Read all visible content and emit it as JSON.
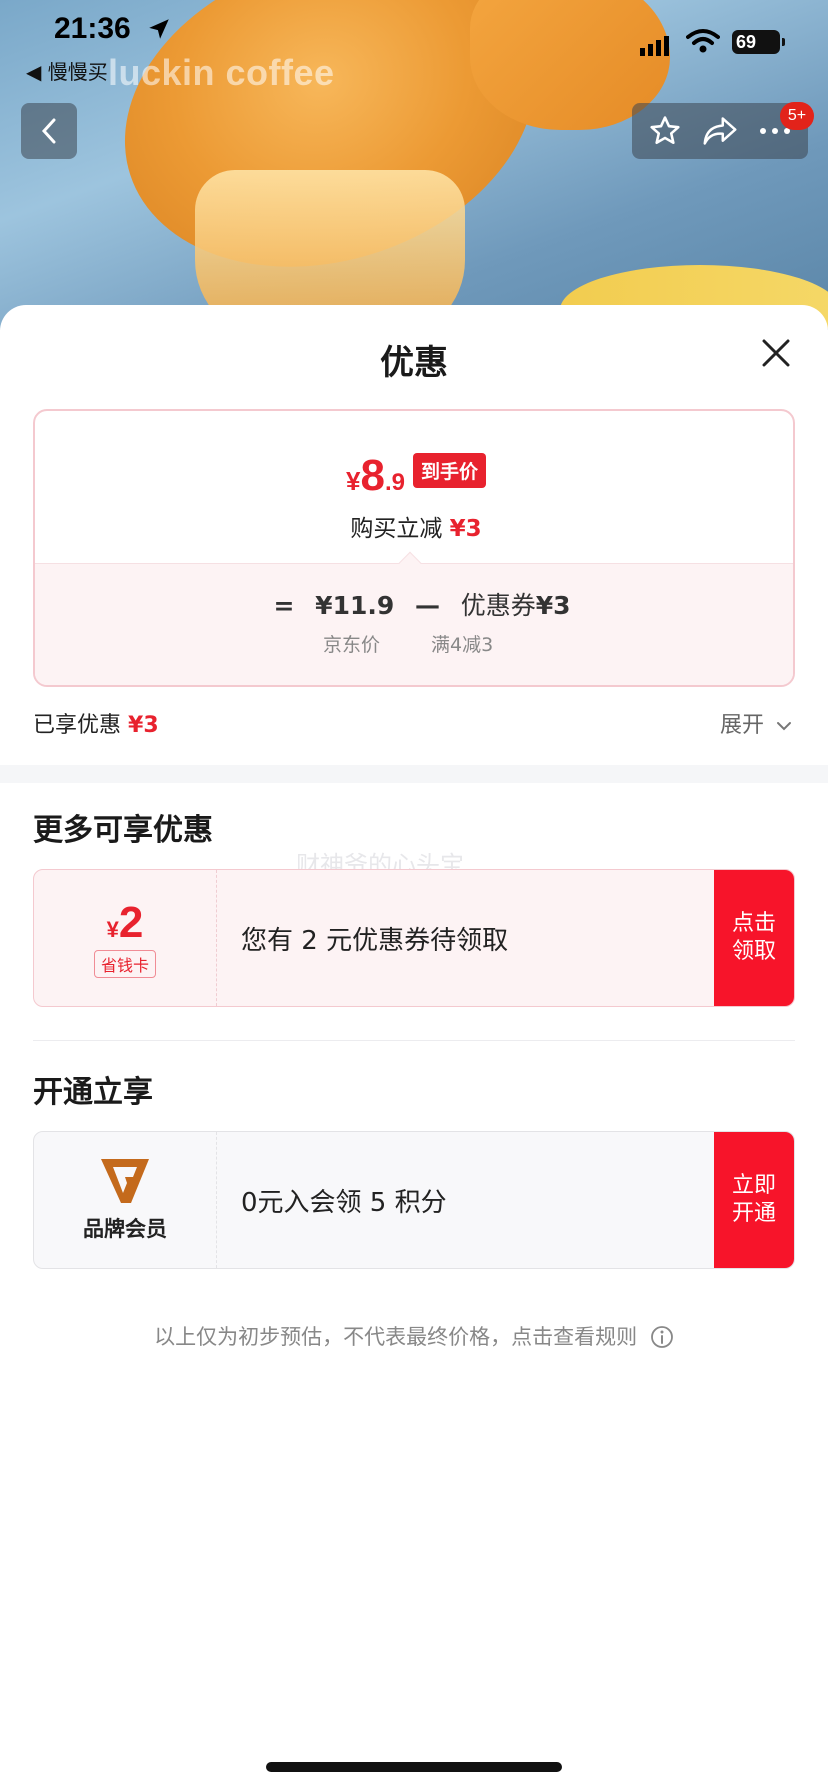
{
  "status_bar": {
    "time": "21:36",
    "back_app": "◀ 慢慢买",
    "battery": "69"
  },
  "hero": {
    "brand_text": "luckin coffee"
  },
  "nav": {
    "message_badge": "5+"
  },
  "sheet": {
    "title": "优惠",
    "price": {
      "currency": "¥",
      "integer": "8",
      "decimal": ".9",
      "tag": "到手价"
    },
    "instant_discount": {
      "label": "购买立减",
      "amount": "¥3"
    },
    "formula": {
      "equals": "=",
      "jd_price": "¥11.9",
      "minus": "—",
      "coupon_label": "优惠券",
      "coupon_amount": "¥3",
      "jd_price_label": "京东价",
      "coupon_rule": "满4减3"
    },
    "enjoyed": {
      "label": "已享优惠",
      "amount": "¥3"
    },
    "expand_label": "展开"
  },
  "more_offers": {
    "title": "更多可享优惠",
    "watermark": "财神爷的心头宝",
    "coupon": {
      "currency": "¥",
      "value": "2",
      "tag": "省钱卡",
      "text": "您有 2 元优惠券待领取",
      "cta": "点击领取"
    }
  },
  "membership": {
    "title": "开通立享",
    "card": {
      "label": "品牌会员",
      "text": "0元入会领 5 积分",
      "cta": "立即开通"
    }
  },
  "footnote": "以上仅为初步预估，不代表最终价格，点击查看规则",
  "colors": {
    "accent_red": "#e8222e",
    "cta_red": "#f7142a",
    "brand_orange": "#c46a1c"
  }
}
